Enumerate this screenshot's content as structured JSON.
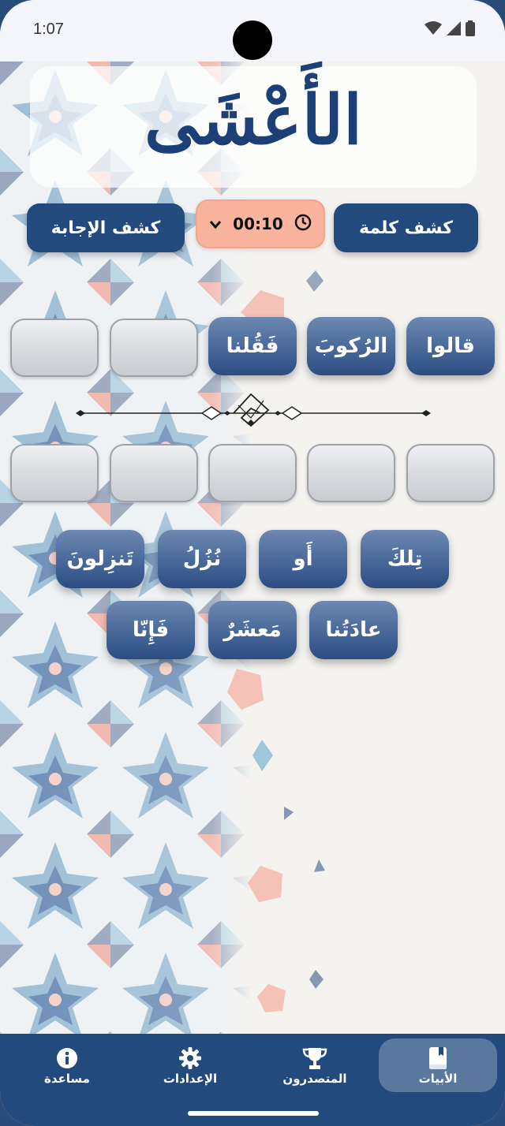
{
  "status": {
    "time": "1:07"
  },
  "header": {
    "title": "الأَعْشَى"
  },
  "controls": {
    "reveal_word": "كشف كلمة",
    "reveal_answer": "كشف الإجابة",
    "timer": "00:10"
  },
  "row1_words": [
    "قالوا",
    "الرُكوبَ",
    "فَقُلنا"
  ],
  "word_bank": [
    "تِلكَ",
    "أَو",
    "نُزُلُ",
    "تَنزِلونَ",
    "عادَتُنا",
    "مَعشَرٌ",
    "فَإِنّا"
  ],
  "nav": {
    "items": [
      {
        "label": "الأبيات",
        "icon": "book-icon",
        "active": true
      },
      {
        "label": "المتصدرون",
        "icon": "trophy-icon",
        "active": false
      },
      {
        "label": "الإعدادات",
        "icon": "gear-icon",
        "active": false
      },
      {
        "label": "مساعدة",
        "icon": "info-icon",
        "active": false
      }
    ]
  },
  "colors": {
    "primary": "#234a7d",
    "timer_bg": "#f9b49e",
    "tile": "#3e5f92",
    "slot": "#d7d9dd"
  }
}
